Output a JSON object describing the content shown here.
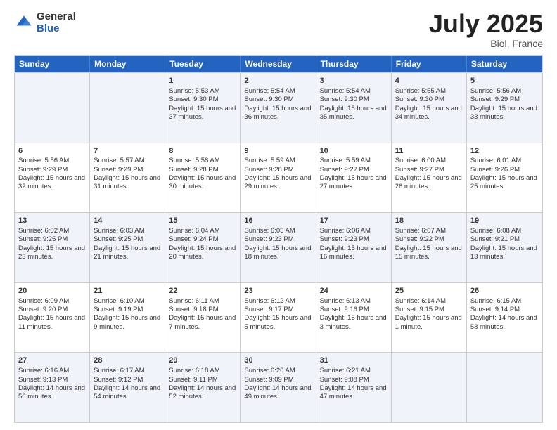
{
  "logo": {
    "general": "General",
    "blue": "Blue"
  },
  "title": {
    "month": "July 2025",
    "location": "Biol, France"
  },
  "header": {
    "days": [
      "Sunday",
      "Monday",
      "Tuesday",
      "Wednesday",
      "Thursday",
      "Friday",
      "Saturday"
    ]
  },
  "rows": [
    [
      {
        "day": "",
        "sunrise": "",
        "sunset": "",
        "daylight": ""
      },
      {
        "day": "",
        "sunrise": "",
        "sunset": "",
        "daylight": ""
      },
      {
        "day": "1",
        "sunrise": "Sunrise: 5:53 AM",
        "sunset": "Sunset: 9:30 PM",
        "daylight": "Daylight: 15 hours and 37 minutes."
      },
      {
        "day": "2",
        "sunrise": "Sunrise: 5:54 AM",
        "sunset": "Sunset: 9:30 PM",
        "daylight": "Daylight: 15 hours and 36 minutes."
      },
      {
        "day": "3",
        "sunrise": "Sunrise: 5:54 AM",
        "sunset": "Sunset: 9:30 PM",
        "daylight": "Daylight: 15 hours and 35 minutes."
      },
      {
        "day": "4",
        "sunrise": "Sunrise: 5:55 AM",
        "sunset": "Sunset: 9:30 PM",
        "daylight": "Daylight: 15 hours and 34 minutes."
      },
      {
        "day": "5",
        "sunrise": "Sunrise: 5:56 AM",
        "sunset": "Sunset: 9:29 PM",
        "daylight": "Daylight: 15 hours and 33 minutes."
      }
    ],
    [
      {
        "day": "6",
        "sunrise": "Sunrise: 5:56 AM",
        "sunset": "Sunset: 9:29 PM",
        "daylight": "Daylight: 15 hours and 32 minutes."
      },
      {
        "day": "7",
        "sunrise": "Sunrise: 5:57 AM",
        "sunset": "Sunset: 9:29 PM",
        "daylight": "Daylight: 15 hours and 31 minutes."
      },
      {
        "day": "8",
        "sunrise": "Sunrise: 5:58 AM",
        "sunset": "Sunset: 9:28 PM",
        "daylight": "Daylight: 15 hours and 30 minutes."
      },
      {
        "day": "9",
        "sunrise": "Sunrise: 5:59 AM",
        "sunset": "Sunset: 9:28 PM",
        "daylight": "Daylight: 15 hours and 29 minutes."
      },
      {
        "day": "10",
        "sunrise": "Sunrise: 5:59 AM",
        "sunset": "Sunset: 9:27 PM",
        "daylight": "Daylight: 15 hours and 27 minutes."
      },
      {
        "day": "11",
        "sunrise": "Sunrise: 6:00 AM",
        "sunset": "Sunset: 9:27 PM",
        "daylight": "Daylight: 15 hours and 26 minutes."
      },
      {
        "day": "12",
        "sunrise": "Sunrise: 6:01 AM",
        "sunset": "Sunset: 9:26 PM",
        "daylight": "Daylight: 15 hours and 25 minutes."
      }
    ],
    [
      {
        "day": "13",
        "sunrise": "Sunrise: 6:02 AM",
        "sunset": "Sunset: 9:25 PM",
        "daylight": "Daylight: 15 hours and 23 minutes."
      },
      {
        "day": "14",
        "sunrise": "Sunrise: 6:03 AM",
        "sunset": "Sunset: 9:25 PM",
        "daylight": "Daylight: 15 hours and 21 minutes."
      },
      {
        "day": "15",
        "sunrise": "Sunrise: 6:04 AM",
        "sunset": "Sunset: 9:24 PM",
        "daylight": "Daylight: 15 hours and 20 minutes."
      },
      {
        "day": "16",
        "sunrise": "Sunrise: 6:05 AM",
        "sunset": "Sunset: 9:23 PM",
        "daylight": "Daylight: 15 hours and 18 minutes."
      },
      {
        "day": "17",
        "sunrise": "Sunrise: 6:06 AM",
        "sunset": "Sunset: 9:23 PM",
        "daylight": "Daylight: 15 hours and 16 minutes."
      },
      {
        "day": "18",
        "sunrise": "Sunrise: 6:07 AM",
        "sunset": "Sunset: 9:22 PM",
        "daylight": "Daylight: 15 hours and 15 minutes."
      },
      {
        "day": "19",
        "sunrise": "Sunrise: 6:08 AM",
        "sunset": "Sunset: 9:21 PM",
        "daylight": "Daylight: 15 hours and 13 minutes."
      }
    ],
    [
      {
        "day": "20",
        "sunrise": "Sunrise: 6:09 AM",
        "sunset": "Sunset: 9:20 PM",
        "daylight": "Daylight: 15 hours and 11 minutes."
      },
      {
        "day": "21",
        "sunrise": "Sunrise: 6:10 AM",
        "sunset": "Sunset: 9:19 PM",
        "daylight": "Daylight: 15 hours and 9 minutes."
      },
      {
        "day": "22",
        "sunrise": "Sunrise: 6:11 AM",
        "sunset": "Sunset: 9:18 PM",
        "daylight": "Daylight: 15 hours and 7 minutes."
      },
      {
        "day": "23",
        "sunrise": "Sunrise: 6:12 AM",
        "sunset": "Sunset: 9:17 PM",
        "daylight": "Daylight: 15 hours and 5 minutes."
      },
      {
        "day": "24",
        "sunrise": "Sunrise: 6:13 AM",
        "sunset": "Sunset: 9:16 PM",
        "daylight": "Daylight: 15 hours and 3 minutes."
      },
      {
        "day": "25",
        "sunrise": "Sunrise: 6:14 AM",
        "sunset": "Sunset: 9:15 PM",
        "daylight": "Daylight: 15 hours and 1 minute."
      },
      {
        "day": "26",
        "sunrise": "Sunrise: 6:15 AM",
        "sunset": "Sunset: 9:14 PM",
        "daylight": "Daylight: 14 hours and 58 minutes."
      }
    ],
    [
      {
        "day": "27",
        "sunrise": "Sunrise: 6:16 AM",
        "sunset": "Sunset: 9:13 PM",
        "daylight": "Daylight: 14 hours and 56 minutes."
      },
      {
        "day": "28",
        "sunrise": "Sunrise: 6:17 AM",
        "sunset": "Sunset: 9:12 PM",
        "daylight": "Daylight: 14 hours and 54 minutes."
      },
      {
        "day": "29",
        "sunrise": "Sunrise: 6:18 AM",
        "sunset": "Sunset: 9:11 PM",
        "daylight": "Daylight: 14 hours and 52 minutes."
      },
      {
        "day": "30",
        "sunrise": "Sunrise: 6:20 AM",
        "sunset": "Sunset: 9:09 PM",
        "daylight": "Daylight: 14 hours and 49 minutes."
      },
      {
        "day": "31",
        "sunrise": "Sunrise: 6:21 AM",
        "sunset": "Sunset: 9:08 PM",
        "daylight": "Daylight: 14 hours and 47 minutes."
      },
      {
        "day": "",
        "sunrise": "",
        "sunset": "",
        "daylight": ""
      },
      {
        "day": "",
        "sunrise": "",
        "sunset": "",
        "daylight": ""
      }
    ]
  ],
  "alt_rows": [
    0,
    2,
    4
  ]
}
